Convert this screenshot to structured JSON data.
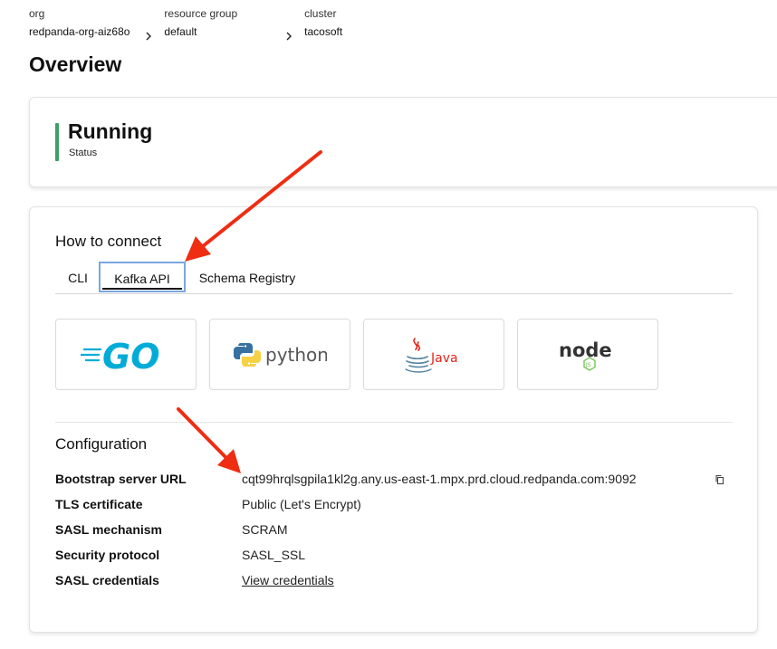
{
  "breadcrumb": [
    {
      "label": "org",
      "value": "redpanda-org-aiz68o"
    },
    {
      "label": "resource group",
      "value": "default"
    },
    {
      "label": "cluster",
      "value": "tacosoft"
    }
  ],
  "page_title": "Overview",
  "status": {
    "value": "Running",
    "label": "Status",
    "color": "#3e9e68"
  },
  "connect": {
    "title": "How to connect",
    "tabs": [
      "CLI",
      "Kafka API",
      "Schema Registry"
    ],
    "active_tab": "Kafka API",
    "languages": [
      {
        "name": "GO",
        "icon": "go-logo-icon"
      },
      {
        "name": "python",
        "icon": "python-logo-icon"
      },
      {
        "name": "Java",
        "icon": "java-logo-icon"
      },
      {
        "name": "node",
        "sub": "JS",
        "icon": "nodejs-logo-icon"
      }
    ]
  },
  "configuration": {
    "title": "Configuration",
    "rows": [
      {
        "key": "Bootstrap server URL",
        "value": "cqt99hrqlsgpila1kl2g.any.us-east-1.mpx.prd.cloud.redpanda.com:9092"
      },
      {
        "key": "TLS certificate",
        "value": "Public (Let's Encrypt)"
      },
      {
        "key": "SASL mechanism",
        "value": "SCRAM"
      },
      {
        "key": "Security protocol",
        "value": "SASL_SSL"
      },
      {
        "key": "SASL credentials",
        "value": "View credentials"
      }
    ]
  },
  "colors": {
    "annotation_arrow": "#ee2d12",
    "active_tab_outline": "#7aa6e0",
    "go_blue": "#00acd7",
    "java_red": "#e2231a"
  }
}
